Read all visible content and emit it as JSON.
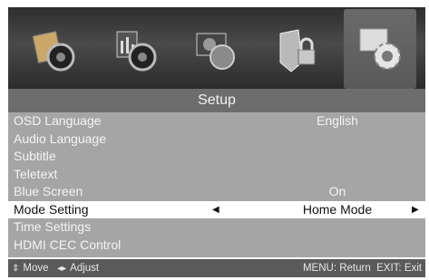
{
  "menu": {
    "title": "Setup",
    "tabs": [
      {
        "name": "picture-tab",
        "icon": "picture-icon"
      },
      {
        "name": "sound-tab",
        "icon": "sound-icon"
      },
      {
        "name": "channel-tab",
        "icon": "channel-icon"
      },
      {
        "name": "lock-tab",
        "icon": "lock-icon"
      },
      {
        "name": "setup-tab",
        "icon": "gear-icon",
        "selected": true
      }
    ],
    "items": [
      {
        "label": "OSD Language",
        "value": "English"
      },
      {
        "label": "Audio Language",
        "value": ""
      },
      {
        "label": "Subtitle",
        "value": ""
      },
      {
        "label": "Teletext",
        "value": ""
      },
      {
        "label": "Blue Screen",
        "value": "On"
      },
      {
        "label": "Mode Setting",
        "value": "Home Mode",
        "selected": true
      },
      {
        "label": "Time Settings",
        "value": ""
      },
      {
        "label": "HDMI CEC Control",
        "value": ""
      }
    ]
  },
  "footer": {
    "move_label": "Move",
    "adjust_label": "Adjust",
    "menu_label": "MENU: Return",
    "exit_label": "EXIT: Exit"
  },
  "colors": {
    "icon_bar": "#3a3a3a",
    "title_bar": "#6d6d6d",
    "list_bg": "#a5a5a5",
    "selected_row": "#ffffff",
    "footer_bg": "#5a5a5a"
  }
}
